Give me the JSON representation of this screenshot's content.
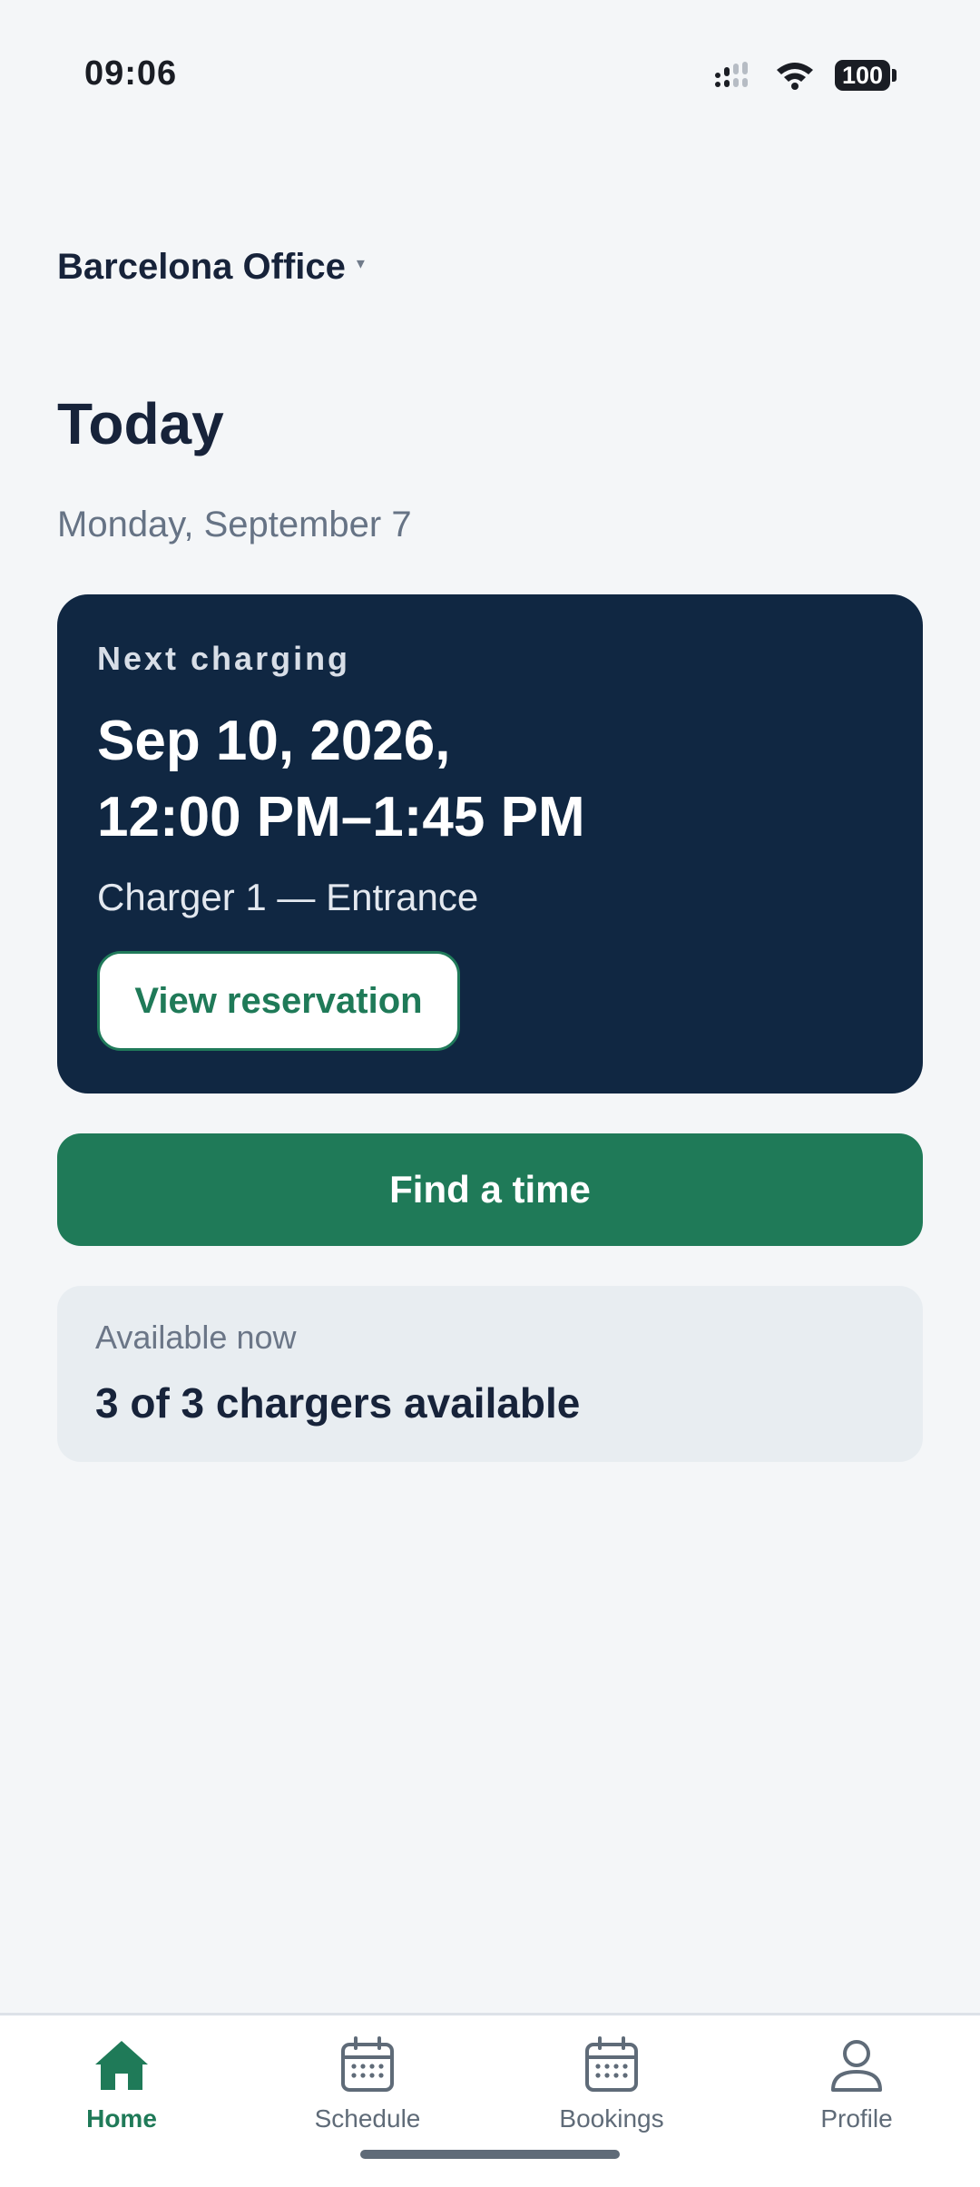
{
  "status_bar": {
    "time": "09:06",
    "battery": "100"
  },
  "location": {
    "name": "Barcelona Office",
    "caret": "▾"
  },
  "header": {
    "title": "Today",
    "date": "Monday, September 7"
  },
  "next_charging": {
    "label": "Next charging",
    "date_line": "Sep 10, 2026,",
    "time_line": "12:00 PM–1:45 PM",
    "charger": "Charger 1 — Entrance",
    "button_label": "View reservation"
  },
  "find_button": {
    "label": "Find a time"
  },
  "availability": {
    "label": "Available now",
    "value": "3 of 3 chargers available"
  },
  "bottom_nav": {
    "items": [
      {
        "label": "Home",
        "icon": "home-icon",
        "active": true
      },
      {
        "label": "Schedule",
        "icon": "calendar-icon",
        "active": false
      },
      {
        "label": "Bookings",
        "icon": "calendar-icon",
        "active": false
      },
      {
        "label": "Profile",
        "icon": "person-icon",
        "active": false
      }
    ]
  },
  "colors": {
    "accent": "#1f7a58",
    "card_dark": "#102742",
    "background": "#f4f6f8"
  }
}
